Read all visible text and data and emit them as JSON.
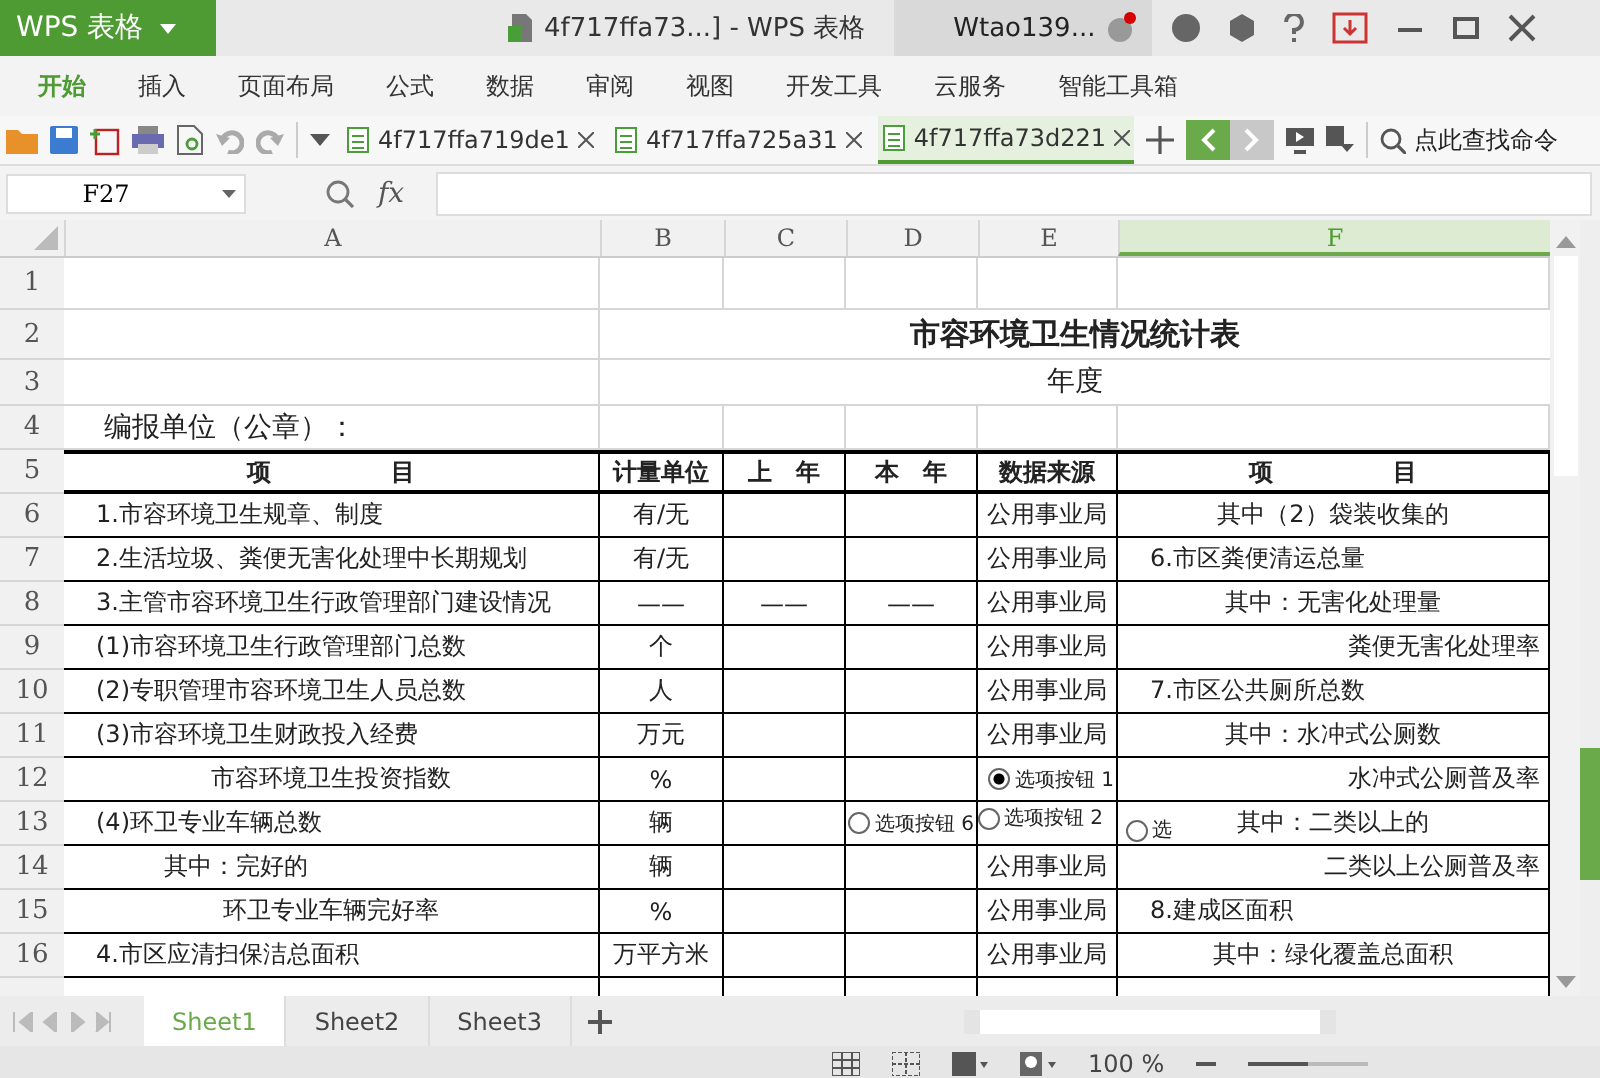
{
  "title_bar": {
    "app_name": "WPS 表格",
    "document_title": "4f717ffa73...] - WPS 表格",
    "user": "Wtao139..."
  },
  "menu_tabs": [
    {
      "label": "开始",
      "selected": true
    },
    {
      "label": "插入",
      "selected": false
    },
    {
      "label": "页面布局",
      "selected": false
    },
    {
      "label": "公式",
      "selected": false
    },
    {
      "label": "数据",
      "selected": false
    },
    {
      "label": "审阅",
      "selected": false
    },
    {
      "label": "视图",
      "selected": false
    },
    {
      "label": "开发工具",
      "selected": false
    },
    {
      "label": "云服务",
      "selected": false
    },
    {
      "label": "智能工具箱",
      "selected": false
    }
  ],
  "doc_tabs": [
    {
      "label": "4f717ffa719de1",
      "selected": false
    },
    {
      "label": "4f717ffa725a31",
      "selected": false
    },
    {
      "label": "4f717ffa73d221",
      "selected": true
    }
  ],
  "search": {
    "placeholder": "点此查找命令"
  },
  "name_box": {
    "value": "F27"
  },
  "formula_bar": {
    "fx_label": "fx"
  },
  "columns": [
    {
      "label": "A",
      "selected": false
    },
    {
      "label": "B",
      "selected": false
    },
    {
      "label": "C",
      "selected": false
    },
    {
      "label": "D",
      "selected": false
    },
    {
      "label": "E",
      "selected": false
    },
    {
      "label": "F",
      "selected": true
    }
  ],
  "rows": [
    {
      "header": "1",
      "kind": "blank"
    },
    {
      "header": "2",
      "kind": "title",
      "banner": "市容环境卫生情况统计表"
    },
    {
      "header": "3",
      "kind": "subtitle",
      "banner": "年度"
    },
    {
      "header": "4",
      "kind": "note",
      "cells": {
        "A": {
          "text": "编报单位（公章）：",
          "kind": "note"
        }
      }
    },
    {
      "header": "5",
      "kind": "head",
      "cells": {
        "A": {
          "text": "项　　　　　目",
          "kind": "center"
        },
        "B": {
          "text": "计量单位",
          "kind": "center"
        },
        "C": {
          "text": "上　年",
          "kind": "center"
        },
        "D": {
          "text": "本　年",
          "kind": "center"
        },
        "E": {
          "text": "数据来源",
          "kind": "center"
        },
        "F": {
          "text": "项　　　　　目",
          "kind": "center"
        }
      }
    },
    {
      "header": "6",
      "kind": "data",
      "cells": {
        "A": {
          "text": "1.市容环境卫生规章、制度",
          "kind": "left"
        },
        "B": {
          "text": "有/无",
          "kind": "center"
        },
        "E": {
          "text": "公用事业局",
          "kind": "center"
        },
        "F": {
          "text": "其中（2）袋装收集的",
          "kind": "center"
        }
      }
    },
    {
      "header": "7",
      "kind": "data",
      "cells": {
        "A": {
          "text": "2.生活垃圾、粪便无害化处理中长期规划",
          "kind": "left"
        },
        "B": {
          "text": "有/无",
          "kind": "center"
        },
        "E": {
          "text": "公用事业局",
          "kind": "center"
        },
        "F": {
          "text": "6.市区粪便清运总量",
          "kind": "left"
        }
      }
    },
    {
      "header": "8",
      "kind": "data",
      "cells": {
        "A": {
          "text": "3.主管市容环境卫生行政管理部门建设情况",
          "kind": "left"
        },
        "B": {
          "text": "——",
          "kind": "center"
        },
        "C": {
          "text": "——",
          "kind": "center"
        },
        "D": {
          "text": "——",
          "kind": "center"
        },
        "E": {
          "text": "公用事业局",
          "kind": "center"
        },
        "F": {
          "text": "其中：无害化处理量",
          "kind": "center"
        }
      }
    },
    {
      "header": "9",
      "kind": "data",
      "cells": {
        "A": {
          "text": "(1)市容环境卫生行政管理部门总数",
          "kind": "left"
        },
        "B": {
          "text": "个",
          "kind": "center"
        },
        "E": {
          "text": "公用事业局",
          "kind": "center"
        },
        "F": {
          "text": "粪便无害化处理率",
          "kind": "right"
        }
      }
    },
    {
      "header": "10",
      "kind": "data",
      "cells": {
        "A": {
          "text": "(2)专职管理市容环境卫生人员总数",
          "kind": "left"
        },
        "B": {
          "text": "人",
          "kind": "center"
        },
        "E": {
          "text": "公用事业局",
          "kind": "center"
        },
        "F": {
          "text": "7.市区公共厕所总数",
          "kind": "left"
        }
      }
    },
    {
      "header": "11",
      "kind": "data",
      "cells": {
        "A": {
          "text": "(3)市容环境卫生财政投入经费",
          "kind": "left"
        },
        "B": {
          "text": "万元",
          "kind": "center"
        },
        "E": {
          "text": "公用事业局",
          "kind": "center"
        },
        "F": {
          "text": "其中：水冲式公厕数",
          "kind": "center"
        }
      }
    },
    {
      "header": "12",
      "kind": "data",
      "cells": {
        "A": {
          "text": "市容环境卫生投资指数",
          "kind": "center"
        },
        "B": {
          "text": "%",
          "kind": "center"
        },
        "F": {
          "text": "水冲式公厕普及率",
          "kind": "right"
        }
      }
    },
    {
      "header": "13",
      "kind": "data",
      "cells": {
        "A": {
          "text": "(4)环卫专业车辆总数",
          "kind": "left"
        },
        "B": {
          "text": "辆",
          "kind": "center"
        },
        "F": {
          "text": "其中：二类以上的",
          "kind": "center"
        }
      }
    },
    {
      "header": "14",
      "kind": "data",
      "cells": {
        "A": {
          "text": "其中：完好的",
          "kind": "indent"
        },
        "B": {
          "text": "辆",
          "kind": "center"
        },
        "E": {
          "text": "公用事业局",
          "kind": "center"
        },
        "F": {
          "text": "二类以上公厕普及率",
          "kind": "right"
        }
      }
    },
    {
      "header": "15",
      "kind": "data",
      "cells": {
        "A": {
          "text": "环卫专业车辆完好率",
          "kind": "center"
        },
        "B": {
          "text": "%",
          "kind": "center"
        },
        "E": {
          "text": "公用事业局",
          "kind": "center"
        },
        "F": {
          "text": "8.建成区面积",
          "kind": "left"
        }
      }
    },
    {
      "header": "16",
      "kind": "data",
      "cells": {
        "A": {
          "text": "4.市区应清扫保洁总面积",
          "kind": "left"
        },
        "B": {
          "text": "万平方米",
          "kind": "center"
        },
        "E": {
          "text": "公用事业局",
          "kind": "center"
        },
        "F": {
          "text": "其中：绿化覆盖总面积",
          "kind": "center"
        }
      }
    }
  ],
  "radio_buttons": [
    {
      "label": "选项按钮 1",
      "selected": true
    },
    {
      "label": "选项按钮 6",
      "selected": false
    },
    {
      "label": "选项按钮 2",
      "selected": false
    },
    {
      "label": "选",
      "selected": false
    }
  ],
  "sheet_tabs": [
    {
      "label": "Sheet1",
      "selected": true
    },
    {
      "label": "Sheet2",
      "selected": false
    },
    {
      "label": "Sheet3",
      "selected": false
    }
  ],
  "status_bar": {
    "zoom": "100 %",
    "zoom_slider": {
      "level": 0.5
    }
  }
}
